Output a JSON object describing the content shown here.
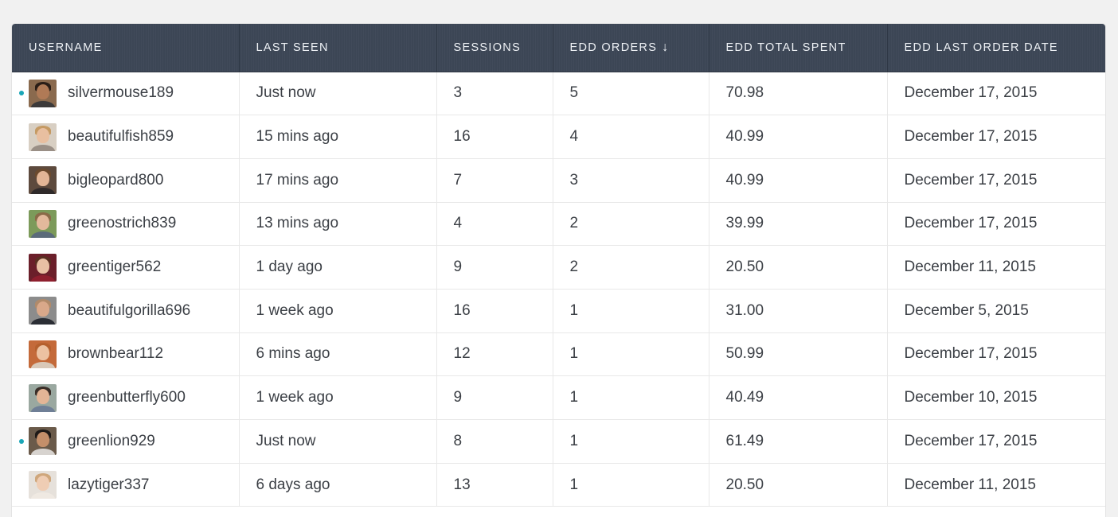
{
  "table": {
    "columns": [
      {
        "key": "username",
        "label": "USERNAME"
      },
      {
        "key": "last_seen",
        "label": "LAST SEEN"
      },
      {
        "key": "sessions",
        "label": "SESSIONS"
      },
      {
        "key": "edd_orders",
        "label": "EDD ORDERS",
        "sort_indicator": "↓"
      },
      {
        "key": "edd_total_spent",
        "label": "EDD TOTAL SPENT"
      },
      {
        "key": "edd_last_order_date",
        "label": "EDD LAST ORDER DATE"
      }
    ],
    "rows": [
      {
        "username": "silvermouse189",
        "online": true,
        "last_seen": "Just now",
        "sessions": "3",
        "edd_orders": "5",
        "edd_total_spent": "70.98",
        "edd_last_order_date": "December 17, 2015",
        "avatar": {
          "bg": "#8a6a4e",
          "skin": "#b07a56",
          "hair": "#2a1d16",
          "shirt": "#3c3a3a"
        }
      },
      {
        "username": "beautifulfish859",
        "online": false,
        "last_seen": "15 mins ago",
        "sessions": "16",
        "edd_orders": "4",
        "edd_total_spent": "40.99",
        "edd_last_order_date": "December 17, 2015",
        "avatar": {
          "bg": "#d8cfc3",
          "skin": "#e8bfa0",
          "hair": "#c59a63",
          "shirt": "#9a8f86"
        }
      },
      {
        "username": "bigleopard800",
        "online": false,
        "last_seen": "17 mins ago",
        "sessions": "7",
        "edd_orders": "3",
        "edd_total_spent": "40.99",
        "edd_last_order_date": "December 17, 2015",
        "avatar": {
          "bg": "#5d4a3d",
          "skin": "#e2b596",
          "hair": "#6b4a2e",
          "shirt": "#2f2a2a"
        }
      },
      {
        "username": "greenostrich839",
        "online": false,
        "last_seen": "13 mins ago",
        "sessions": "4",
        "edd_orders": "2",
        "edd_total_spent": "39.99",
        "edd_last_order_date": "December 17, 2015",
        "avatar": {
          "bg": "#7c9a5a",
          "skin": "#e3b99c",
          "hair": "#8a6a48",
          "shirt": "#5b6b7a"
        }
      },
      {
        "username": "greentiger562",
        "online": false,
        "last_seen": "1 day ago",
        "sessions": "9",
        "edd_orders": "2",
        "edd_total_spent": "20.50",
        "edd_last_order_date": "December 11, 2015",
        "avatar": {
          "bg": "#6b1f2a",
          "skin": "#e8c0a4",
          "hair": "#5a2f22",
          "shirt": "#8e1f2e"
        }
      },
      {
        "username": "beautifulgorilla696",
        "online": false,
        "last_seen": "1 week ago",
        "sessions": "16",
        "edd_orders": "1",
        "edd_total_spent": "31.00",
        "edd_last_order_date": "December 5, 2015",
        "avatar": {
          "bg": "#8c8c8c",
          "skin": "#d9a88a",
          "hair": "#b08a6a",
          "shirt": "#2b2e35"
        }
      },
      {
        "username": "brownbear112",
        "online": false,
        "last_seen": "6 mins ago",
        "sessions": "12",
        "edd_orders": "1",
        "edd_total_spent": "50.99",
        "edd_last_order_date": "December 17, 2015",
        "avatar": {
          "bg": "#c46a3a",
          "skin": "#ecc2a2",
          "hair": "#b5602e",
          "shirt": "#d9c8b8"
        }
      },
      {
        "username": "greenbutterfly600",
        "online": false,
        "last_seen": "1 week ago",
        "sessions": "9",
        "edd_orders": "1",
        "edd_total_spent": "40.49",
        "edd_last_order_date": "December 10, 2015",
        "avatar": {
          "bg": "#9aa8a0",
          "skin": "#e3b596",
          "hair": "#3a2e28",
          "shirt": "#6f7f96"
        }
      },
      {
        "username": "greenlion929",
        "online": true,
        "last_seen": "Just now",
        "sessions": "8",
        "edd_orders": "1",
        "edd_total_spent": "61.49",
        "edd_last_order_date": "December 17, 2015",
        "avatar": {
          "bg": "#6a5a4a",
          "skin": "#c48f6a",
          "hair": "#1f1a18",
          "shirt": "#d7d3cf"
        }
      },
      {
        "username": "lazytiger337",
        "online": false,
        "last_seen": "6 days ago",
        "sessions": "13",
        "edd_orders": "1",
        "edd_total_spent": "20.50",
        "edd_last_order_date": "December 11, 2015",
        "avatar": {
          "bg": "#e6e1db",
          "skin": "#efcdb4",
          "hair": "#cfa77c",
          "shirt": "#efe9e2"
        }
      }
    ]
  },
  "colors": {
    "header_bg": "#3d4757",
    "header_text": "#eef1f5",
    "online_dot": "#1aa6b7",
    "cell_text": "#3b3f45"
  }
}
